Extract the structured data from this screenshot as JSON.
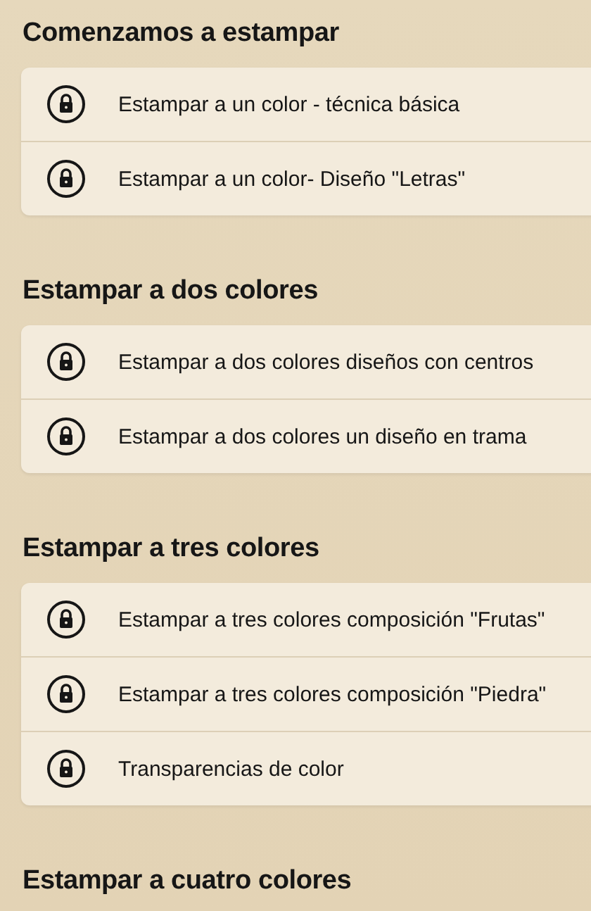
{
  "sections": [
    {
      "title": "Comenzamos a estampar",
      "lessons": [
        {
          "label": "Estampar a un color - técnica básica",
          "locked": true
        },
        {
          "label": "Estampar a un color- Diseño \"Letras\"",
          "locked": true
        }
      ]
    },
    {
      "title": "Estampar a dos colores",
      "lessons": [
        {
          "label": "Estampar a dos colores diseños con centros",
          "locked": true
        },
        {
          "label": "Estampar a dos colores un diseño en trama",
          "locked": true
        }
      ]
    },
    {
      "title": "Estampar a tres colores",
      "lessons": [
        {
          "label": "Estampar a tres colores composición \"Frutas\"",
          "locked": true
        },
        {
          "label": "Estampar a tres colores composición \"Piedra\"",
          "locked": true
        },
        {
          "label": "Transparencias de color",
          "locked": true
        }
      ]
    },
    {
      "title": "Estampar a cuatro colores"
    }
  ]
}
